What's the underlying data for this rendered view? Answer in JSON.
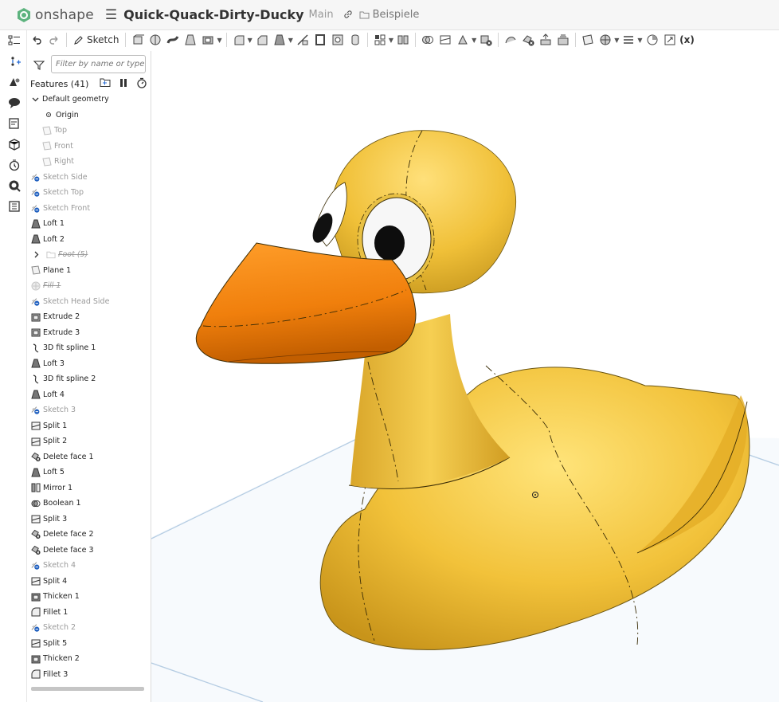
{
  "app": {
    "brand": "onshape",
    "document_title": "Quick-Quack-Dirty-Ducky",
    "branch": "Main",
    "folder": "Beispiele"
  },
  "toolbar": {
    "sketch_label": "Sketch",
    "variable_label": "(x)"
  },
  "panel": {
    "filter_placeholder": "Filter by name or type",
    "features_title": "Features (41)",
    "default_geometry": "Default geometry",
    "items": [
      {
        "label": "Origin",
        "icon": "origin-icon",
        "state": "normal",
        "indent": 2
      },
      {
        "label": "Top",
        "icon": "plane-icon",
        "state": "dim",
        "indent": 1
      },
      {
        "label": "Front",
        "icon": "plane-icon",
        "state": "dim",
        "indent": 1
      },
      {
        "label": "Right",
        "icon": "plane-icon",
        "state": "dim",
        "indent": 1
      },
      {
        "label": "Sketch Side",
        "icon": "sketch-icon",
        "state": "sup",
        "indent": 0
      },
      {
        "label": "Sketch Top",
        "icon": "sketch-icon",
        "state": "sup",
        "indent": 0
      },
      {
        "label": "Sketch Front",
        "icon": "sketch-icon",
        "state": "sup",
        "indent": 0
      },
      {
        "label": "Loft 1",
        "icon": "loft-icon",
        "state": "normal",
        "indent": 0
      },
      {
        "label": "Loft 2",
        "icon": "loft-icon",
        "state": "normal",
        "indent": 0
      },
      {
        "label": "Foot (5)",
        "icon": "folder-icon",
        "state": "del",
        "indent": 0,
        "expander": true
      },
      {
        "label": "Plane 1",
        "icon": "plane-icon",
        "state": "normal",
        "indent": 0
      },
      {
        "label": "Fill 1",
        "icon": "fill-icon",
        "state": "del",
        "indent": 0
      },
      {
        "label": "Sketch Head Side",
        "icon": "sketch-icon",
        "state": "sup",
        "indent": 0
      },
      {
        "label": "Extrude 2",
        "icon": "extrude-icon",
        "state": "normal",
        "indent": 0
      },
      {
        "label": "Extrude 3",
        "icon": "extrude-icon",
        "state": "normal",
        "indent": 0
      },
      {
        "label": "3D fit spline 1",
        "icon": "spline-icon",
        "state": "normal",
        "indent": 0
      },
      {
        "label": "Loft 3",
        "icon": "loft-icon",
        "state": "normal",
        "indent": 0
      },
      {
        "label": "3D fit spline 2",
        "icon": "spline-icon",
        "state": "normal",
        "indent": 0
      },
      {
        "label": "Loft 4",
        "icon": "loft-icon",
        "state": "normal",
        "indent": 0
      },
      {
        "label": "Sketch 3",
        "icon": "sketch-icon",
        "state": "sup",
        "indent": 0
      },
      {
        "label": "Split 1",
        "icon": "split-icon",
        "state": "normal",
        "indent": 0
      },
      {
        "label": "Split 2",
        "icon": "split-icon",
        "state": "normal",
        "indent": 0
      },
      {
        "label": "Delete face 1",
        "icon": "delete-face-icon",
        "state": "normal",
        "indent": 0
      },
      {
        "label": "Loft 5",
        "icon": "loft-icon",
        "state": "normal",
        "indent": 0
      },
      {
        "label": "Mirror 1",
        "icon": "mirror-icon",
        "state": "normal",
        "indent": 0
      },
      {
        "label": "Boolean 1",
        "icon": "boolean-icon",
        "state": "normal",
        "indent": 0
      },
      {
        "label": "Split 3",
        "icon": "split-icon",
        "state": "normal",
        "indent": 0
      },
      {
        "label": "Delete face 2",
        "icon": "delete-face-icon",
        "state": "normal",
        "indent": 0
      },
      {
        "label": "Delete face 3",
        "icon": "delete-face-icon",
        "state": "normal",
        "indent": 0
      },
      {
        "label": "Sketch 4",
        "icon": "sketch-icon",
        "state": "sup",
        "indent": 0
      },
      {
        "label": "Split 4",
        "icon": "split-icon",
        "state": "normal",
        "indent": 0
      },
      {
        "label": "Thicken 1",
        "icon": "thicken-icon",
        "state": "normal",
        "indent": 0
      },
      {
        "label": "Fillet 1",
        "icon": "fillet-icon",
        "state": "normal",
        "indent": 0
      },
      {
        "label": "Sketch 2",
        "icon": "sketch-icon",
        "state": "sup",
        "indent": 0
      },
      {
        "label": "Split 5",
        "icon": "split-icon",
        "state": "normal",
        "indent": 0
      },
      {
        "label": "Thicken 2",
        "icon": "thicken-icon",
        "state": "normal",
        "indent": 0
      },
      {
        "label": "Fillet 3",
        "icon": "fillet-icon",
        "state": "normal",
        "indent": 0
      }
    ]
  },
  "colors": {
    "brand_green": "#3c9a5f",
    "duck_body": "#f2c23a",
    "duck_beak": "#f07f0c",
    "plane": "#dce9f5",
    "suppressed_badge": "#1f5fbf"
  }
}
